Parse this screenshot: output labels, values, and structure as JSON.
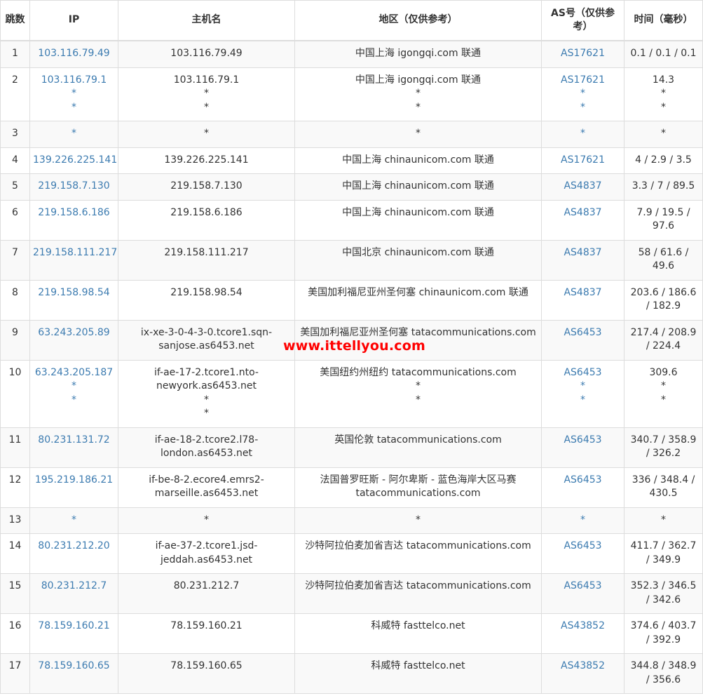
{
  "headers": {
    "hop": "跳数",
    "ip": "IP",
    "host": "主机名",
    "region": "地区（仅供参考）",
    "as": "AS号（仅供参考）",
    "time": "时间（毫秒）"
  },
  "watermark": "www.ittellyou.com",
  "colors": {
    "link": "#3c7bb0",
    "watermark": "#ff0000",
    "row_alt": "#f9f9f9",
    "border": "#dddddd"
  },
  "rows": [
    {
      "hop": "1",
      "ip": [
        "103.116.79.49"
      ],
      "host": [
        "103.116.79.49"
      ],
      "region": [
        "中国上海 igongqi.com 联通"
      ],
      "as": [
        "AS17621"
      ],
      "time": [
        "0.1 / 0.1 / 0.1"
      ]
    },
    {
      "hop": "2",
      "ip": [
        "103.116.79.1",
        "*",
        "*"
      ],
      "host": [
        "103.116.79.1",
        "*",
        "*"
      ],
      "region": [
        "中国上海 igongqi.com 联通",
        "*",
        "*"
      ],
      "as": [
        "AS17621",
        "*",
        "*"
      ],
      "time": [
        "14.3",
        "*",
        "*"
      ]
    },
    {
      "hop": "3",
      "ip": [
        "*"
      ],
      "host": [
        "*"
      ],
      "region": [
        "*"
      ],
      "as": [
        "*"
      ],
      "time": [
        "*"
      ]
    },
    {
      "hop": "4",
      "ip": [
        "139.226.225.141"
      ],
      "host": [
        "139.226.225.141"
      ],
      "region": [
        "中国上海 chinaunicom.com 联通"
      ],
      "as": [
        "AS17621"
      ],
      "time": [
        "4 / 2.9 / 3.5"
      ]
    },
    {
      "hop": "5",
      "ip": [
        "219.158.7.130"
      ],
      "host": [
        "219.158.7.130"
      ],
      "region": [
        "中国上海 chinaunicom.com 联通"
      ],
      "as": [
        "AS4837"
      ],
      "time": [
        "3.3 / 7 / 89.5"
      ]
    },
    {
      "hop": "6",
      "ip": [
        "219.158.6.186"
      ],
      "host": [
        "219.158.6.186"
      ],
      "region": [
        "中国上海 chinaunicom.com 联通"
      ],
      "as": [
        "AS4837"
      ],
      "time": [
        "7.9 / 19.5 /",
        "97.6"
      ]
    },
    {
      "hop": "7",
      "ip": [
        "219.158.111.217"
      ],
      "host": [
        "219.158.111.217"
      ],
      "region": [
        "中国北京 chinaunicom.com 联通"
      ],
      "as": [
        "AS4837"
      ],
      "time": [
        "58 / 61.6 /",
        "49.6"
      ]
    },
    {
      "hop": "8",
      "ip": [
        "219.158.98.54"
      ],
      "host": [
        "219.158.98.54"
      ],
      "region": [
        "美国加利福尼亚州圣何塞 chinaunicom.com 联通"
      ],
      "as": [
        "AS4837"
      ],
      "time": [
        "203.6 / 186.6",
        "/ 182.9"
      ]
    },
    {
      "hop": "9",
      "ip": [
        "63.243.205.89"
      ],
      "host": [
        "ix-xe-3-0-4-3-0.tcore1.sqn-",
        "sanjose.as6453.net"
      ],
      "region": [
        "美国加利福尼亚州圣何塞 tatacommunications.com"
      ],
      "as": [
        "AS6453"
      ],
      "time": [
        "217.4 / 208.9",
        "/ 224.4"
      ]
    },
    {
      "hop": "10",
      "ip": [
        "63.243.205.187",
        "*",
        "*"
      ],
      "host": [
        "if-ae-17-2.tcore1.nto-",
        "newyork.as6453.net",
        "*",
        "*"
      ],
      "region": [
        "美国纽约州纽约 tatacommunications.com",
        "*",
        "*"
      ],
      "as": [
        "AS6453",
        "*",
        "*"
      ],
      "time": [
        "309.6",
        "*",
        "*"
      ]
    },
    {
      "hop": "11",
      "ip": [
        "80.231.131.72"
      ],
      "host": [
        "if-ae-18-2.tcore2.l78-",
        "london.as6453.net"
      ],
      "region": [
        "英国伦敦 tatacommunications.com"
      ],
      "as": [
        "AS6453"
      ],
      "time": [
        "340.7 / 358.9",
        "/ 326.2"
      ]
    },
    {
      "hop": "12",
      "ip": [
        "195.219.186.21"
      ],
      "host": [
        "if-be-8-2.ecore4.emrs2-",
        "marseille.as6453.net"
      ],
      "region": [
        "法国普罗旺斯 - 阿尔卑斯 - 蓝色海岸大区马赛",
        "tatacommunications.com"
      ],
      "as": [
        "AS6453"
      ],
      "time": [
        "336 / 348.4 /",
        "430.5"
      ]
    },
    {
      "hop": "13",
      "ip": [
        "*"
      ],
      "host": [
        "*"
      ],
      "region": [
        "*"
      ],
      "as": [
        "*"
      ],
      "time": [
        "*"
      ]
    },
    {
      "hop": "14",
      "ip": [
        "80.231.212.20"
      ],
      "host": [
        "if-ae-37-2.tcore1.jsd-",
        "jeddah.as6453.net"
      ],
      "region": [
        "沙特阿拉伯麦加省吉达 tatacommunications.com"
      ],
      "as": [
        "AS6453"
      ],
      "time": [
        "411.7 / 362.7",
        "/ 349.9"
      ]
    },
    {
      "hop": "15",
      "ip": [
        "80.231.212.7"
      ],
      "host": [
        "80.231.212.7"
      ],
      "region": [
        "沙特阿拉伯麦加省吉达 tatacommunications.com"
      ],
      "as": [
        "AS6453"
      ],
      "time": [
        "352.3 / 346.5",
        "/ 342.6"
      ]
    },
    {
      "hop": "16",
      "ip": [
        "78.159.160.21"
      ],
      "host": [
        "78.159.160.21"
      ],
      "region": [
        "科威特 fasttelco.net"
      ],
      "as": [
        "AS43852"
      ],
      "time": [
        "374.6 / 403.7",
        "/ 392.9"
      ]
    },
    {
      "hop": "17",
      "ip": [
        "78.159.160.65"
      ],
      "host": [
        "78.159.160.65"
      ],
      "region": [
        "科威特 fasttelco.net"
      ],
      "as": [
        "AS43852"
      ],
      "time": [
        "344.8 / 348.9",
        "/ 356.6"
      ]
    }
  ]
}
